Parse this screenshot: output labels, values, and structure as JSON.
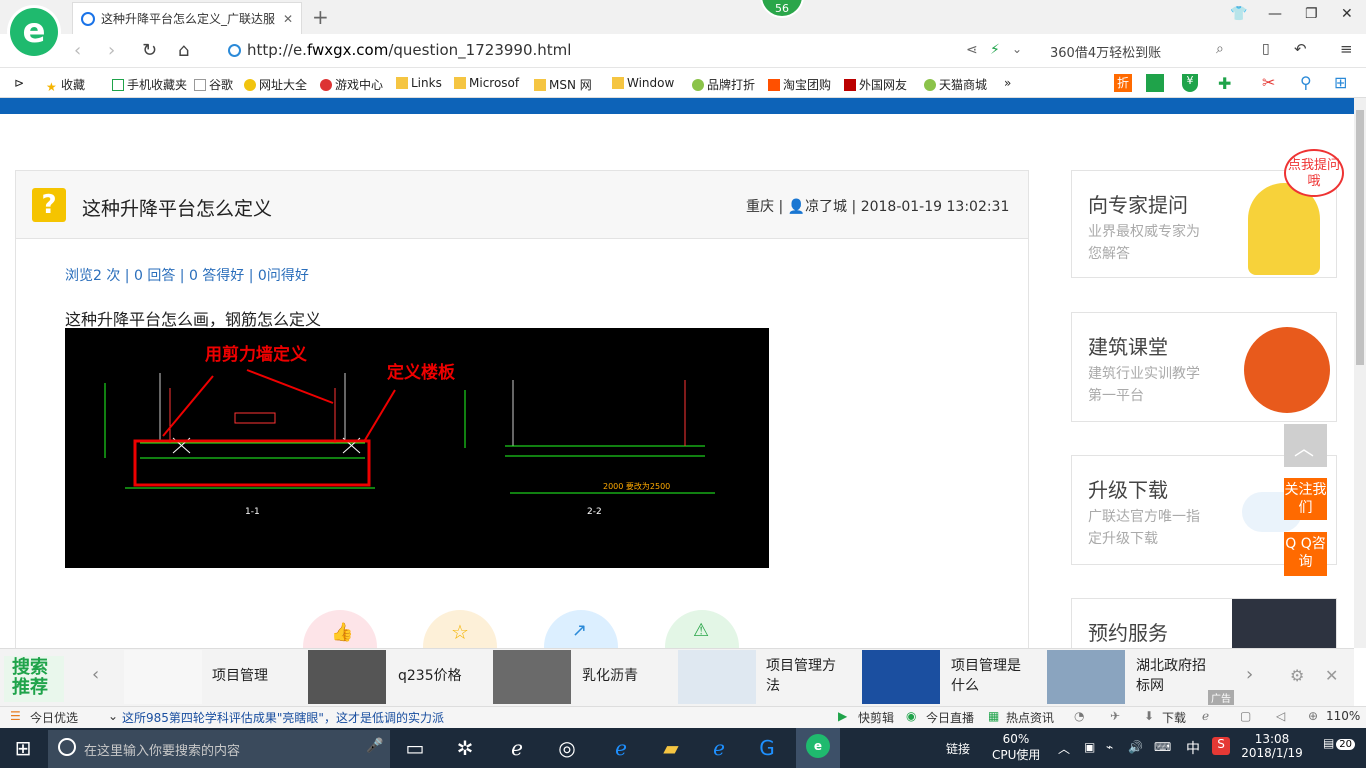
{
  "browser": {
    "tab_title": "这种升降平台怎么定义_广联达服",
    "new_tab": "+",
    "badge_count": "56",
    "url_prefix": "http://e.",
    "url_domain": "fwxgx.com",
    "url_path": "/question_1723990.html",
    "search_placeholder": "360借4万轻松到账",
    "window_controls": [
      "restore-down-icon",
      "minimize-icon",
      "maximize-icon",
      "close-icon"
    ]
  },
  "bookmarks": {
    "collapse": "⊳",
    "items": [
      "收藏",
      "手机收藏夹",
      "谷歌",
      "网址大全",
      "游戏中心",
      "Links",
      "Microsof",
      "MSN 网",
      "Window",
      "品牌打折",
      "淘宝团购",
      "外国网友",
      "天猫商城"
    ],
    "more": "»"
  },
  "question": {
    "title": "这种升降平台怎么定义",
    "location": "重庆",
    "separator": " | ",
    "user": "凉了城",
    "datetime": "2018-01-19 13:02:31",
    "stats": "浏览2 次 | 0 回答 | 0 答得好 | 0问得好",
    "body": "这种升降平台怎么画，钢筋怎么定义",
    "annotation_1": "用剪力墙定义",
    "annotation_2": "定义楼板",
    "section_1": "1-1",
    "section_2": "2-2",
    "dimension_note": "2000 要改为2500"
  },
  "sidebar": {
    "expert_title": "向专家提问",
    "expert_sub": "业界最权威专家为您解答",
    "expert_bubble": "点我提问哦",
    "course_title": "建筑课堂",
    "course_sub": "建筑行业实训教学第一平台",
    "upgrade_title": "升级下载",
    "upgrade_sub": "广联达官方唯一指定升级下载",
    "booking_title": "预约服务",
    "follow_us": "关注我们",
    "qq_consult": "Q Q咨询"
  },
  "recommend": {
    "title": "搜索推荐",
    "items": [
      "项目管理",
      "q235价格",
      "乳化沥青",
      "项目管理方法",
      "项目管理是什么",
      "湖北政府招标网"
    ],
    "ad_label": "广告"
  },
  "statusbar": {
    "today_pick": "今日优选",
    "headline": "这所985第四轮学科评估成果\"亮瞎眼\"，这才是低调的实力派",
    "quick_cut": "快剪辑",
    "live": "今日直播",
    "hot_news": "热点资讯",
    "download": "下载",
    "zoom": "110%"
  },
  "taskbar": {
    "search_placeholder": "在这里输入你要搜索的内容",
    "link_label": "链接",
    "cpu_percent": "60%",
    "cpu_label": "CPU使用",
    "ime": "中",
    "time": "13:08",
    "date": "2018/1/19",
    "notifications": "20"
  },
  "colors": {
    "accent_green": "#1fba6e",
    "header_blue": "#0d63b8",
    "follow_orange": "#ff6a00",
    "link_blue": "#2a6ebb"
  }
}
